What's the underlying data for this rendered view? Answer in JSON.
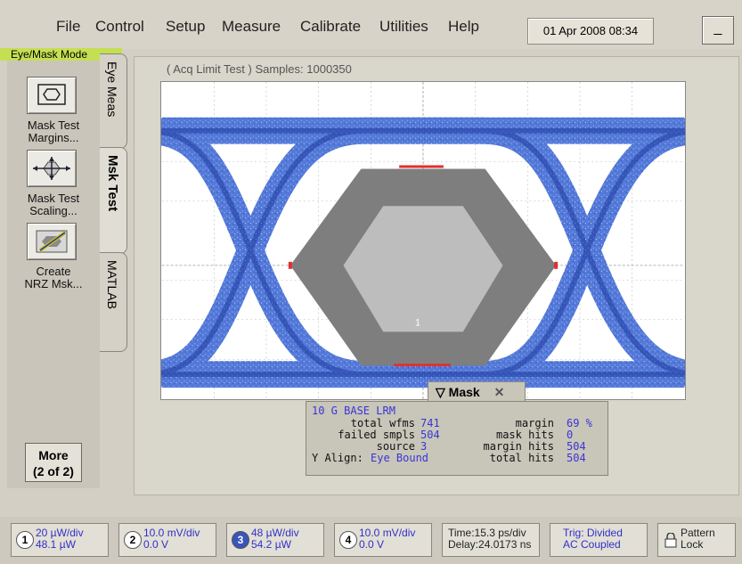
{
  "menu": {
    "file": "File",
    "control": "Control",
    "setup": "Setup",
    "measure": "Measure",
    "calibrate": "Calibrate",
    "utilities": "Utilities",
    "help": "Help"
  },
  "datetime": "01 Apr 2008  08:34",
  "minimize_label": "_",
  "mode_label": "Eye/Mask Mode",
  "left_panel": {
    "mask_margins": [
      "Mask Test",
      "Margins..."
    ],
    "mask_scaling": [
      "Mask Test",
      "Scaling..."
    ],
    "create_nrz": [
      "Create",
      "NRZ Msk..."
    ],
    "more": [
      "More",
      "(2 of 2)"
    ]
  },
  "tabs": {
    "eye_meas": "Eye Meas",
    "msk_test": "Msk Test",
    "matlab": "MATLAB"
  },
  "acq_status": "( Acq Limit Test )  Samples: 1000350",
  "marker_label": "1",
  "mask_panel": {
    "title": "Mask",
    "standard": "10 G BASE LRM",
    "total_wfms_label": "total wfms",
    "total_wfms": "741",
    "failed_smpls_label": "failed smpls",
    "failed_smpls": "504",
    "source_label": "source",
    "source": "3",
    "y_align_label": "Y Align:",
    "y_align": "Eye Bound",
    "margin_label": "margin",
    "margin": "69 %",
    "mask_hits_label": "mask hits",
    "mask_hits": "0",
    "margin_hits_label": "margin hits",
    "margin_hits": "504",
    "total_hits_label": "total hits",
    "total_hits": "504"
  },
  "channels": [
    {
      "num": "1",
      "line1": "20 µW/div",
      "line2": "48.1 µW"
    },
    {
      "num": "2",
      "line1": "10.0 mV/div",
      "line2": "0.0 V"
    },
    {
      "num": "3",
      "line1": "48 µW/div",
      "line2": "54.2 µW"
    },
    {
      "num": "4",
      "line1": "10.0 mV/div",
      "line2": "0.0 V"
    }
  ],
  "timebase": {
    "line1": "Time:15.3 ps/div",
    "line2": "Delay:24.0173 ns"
  },
  "trigger": {
    "line1": "Trig: Divided",
    "line2": "AC Coupled"
  },
  "pattern_lock": [
    "Pattern",
    "Lock"
  ],
  "colors": {
    "eye_trace": "#3f67d4",
    "mask_outer": "#7e7e7e",
    "mask_inner": "#bdbdbd",
    "hits": "#e03030",
    "mode_label_bg": "#c5df52"
  }
}
